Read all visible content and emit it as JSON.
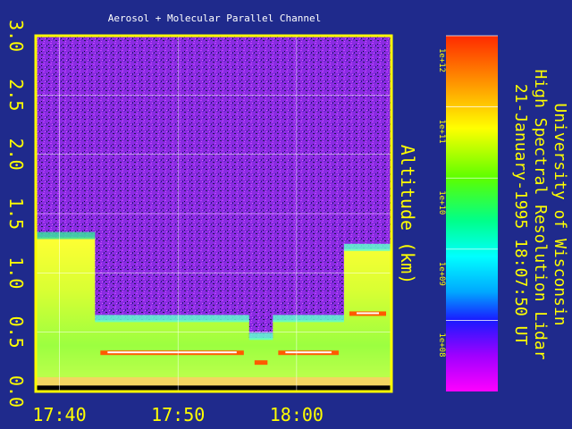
{
  "chart_data": {
    "type": "heatmap",
    "title": "Aerosol + Molecular Parallel Channel",
    "xlabel": "",
    "ylabel": "Altitude (km)",
    "x_ticks": [
      "17:40",
      "17:50",
      "18:00"
    ],
    "x_range": [
      "17:38",
      "18:08"
    ],
    "y_ticks": [
      "0.0",
      "0.5",
      "1.0",
      "1.5",
      "2.0",
      "2.5",
      "3.0"
    ],
    "ylim": [
      0,
      3.0
    ],
    "grid": true,
    "colorbar": {
      "scale": "log",
      "range": [
        10000000.0,
        1000000000000.0
      ],
      "ticks": [
        "1e+12",
        "1e+11",
        "1e+10",
        "1e+09",
        "1e+08"
      ]
    },
    "layers": [
      {
        "start": "17:38",
        "end": "17:43",
        "top_km": 1.3,
        "level": "green"
      },
      {
        "start": "17:43",
        "end": "17:56",
        "top_km": 0.6,
        "level": "yellow"
      },
      {
        "start": "17:56",
        "end": "17:58",
        "top_km": 0.45,
        "level": "yellow"
      },
      {
        "start": "17:58",
        "end": "18:04",
        "top_km": 0.6,
        "level": "yellow"
      },
      {
        "start": "18:04",
        "end": "18:08",
        "top_km": 1.2,
        "level": "yellow"
      }
    ]
  },
  "side_text": {
    "institution": "University of Wisconsin",
    "instrument": "High Spectral Resolution Lidar",
    "timestamp": "21-January-1995 18:07:50 UT"
  },
  "colors": {
    "background": "#1f2a8c",
    "frame": "#ffff00",
    "label": "#ffff00",
    "title": "#ffffff"
  }
}
